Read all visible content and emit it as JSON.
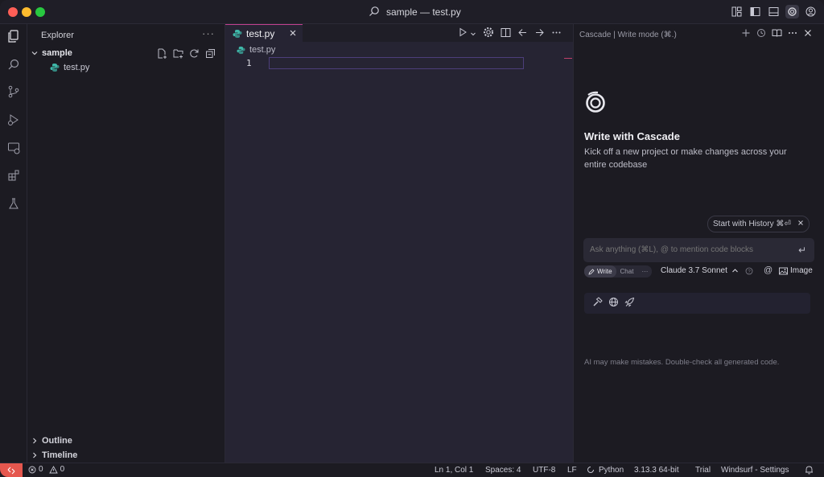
{
  "window": {
    "title": "sample — test.py"
  },
  "explorer": {
    "title": "Explorer",
    "more": "···",
    "folder": "sample",
    "file": "test.py",
    "outline": "Outline",
    "timeline": "Timeline"
  },
  "editor": {
    "tab_label": "test.py",
    "breadcrumb_file": "test.py",
    "line_number": "1"
  },
  "cascade": {
    "title": "Cascade | Write mode (⌘.)",
    "heading": "Write with Cascade",
    "subtitle": "Kick off a new project or make changes across your entire codebase",
    "history_pill": "Start with History ⌘⏎",
    "input_placeholder": "Ask anything (⌘L), @ to mention code blocks",
    "enter_glyph": "↵",
    "mode_write": "Write",
    "mode_chat": "Chat",
    "mode_more": "···",
    "model": "Claude 3.7 Sonnet",
    "at_symbol": "@",
    "image_label": "Image",
    "disclaimer": "AI may make mistakes. Double-check all generated code."
  },
  "status": {
    "errors": "0",
    "warnings": "0",
    "position": "Ln 1, Col 1",
    "spaces": "Spaces: 4",
    "encoding": "UTF-8",
    "eol": "LF",
    "language": "Python",
    "interpreter": "3.13.3 64-bit",
    "trial": "Trial",
    "settings": "Windsurf - Settings"
  },
  "colors": {
    "accent_tab": "#c0408f",
    "remote_indicator": "#e5574e",
    "python_icon": "#3fb8a9"
  }
}
